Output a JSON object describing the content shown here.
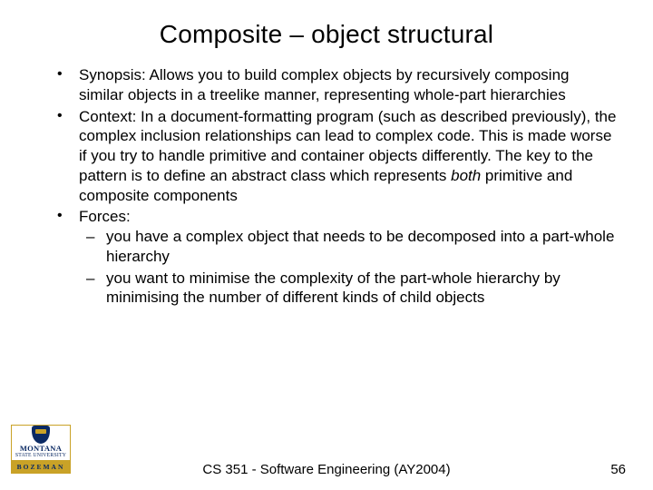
{
  "title": "Composite – object structural",
  "bullets": {
    "b1_label": "Synopsis:",
    "b1_text": " Allows you to build complex objects by recursively composing similar objects in a treelike manner, representing whole-part hierarchies",
    "b2_label": "Context:",
    "b2_text_a": " In a document-formatting program (such as described previously), the complex inclusion relationships can lead to complex code. This is made worse if you try to handle primitive and container objects differently. The key to the pattern is to define an abstract class which represents ",
    "b2_italic": "both",
    "b2_text_b": " primitive and composite components",
    "b3_label": "Forces:",
    "sub1": "you have a complex object that needs to be decomposed into a part-whole hierarchy",
    "sub2": "you want to minimise the complexity of the part-whole hierarchy by minimising the number of different kinds of child objects"
  },
  "footer": {
    "center": "CS 351 - Software Engineering (AY2004)",
    "page": "56"
  },
  "logo": {
    "line1": "MONTANA",
    "line2": "STATE UNIVERSITY",
    "line3": "BOZEMAN"
  }
}
